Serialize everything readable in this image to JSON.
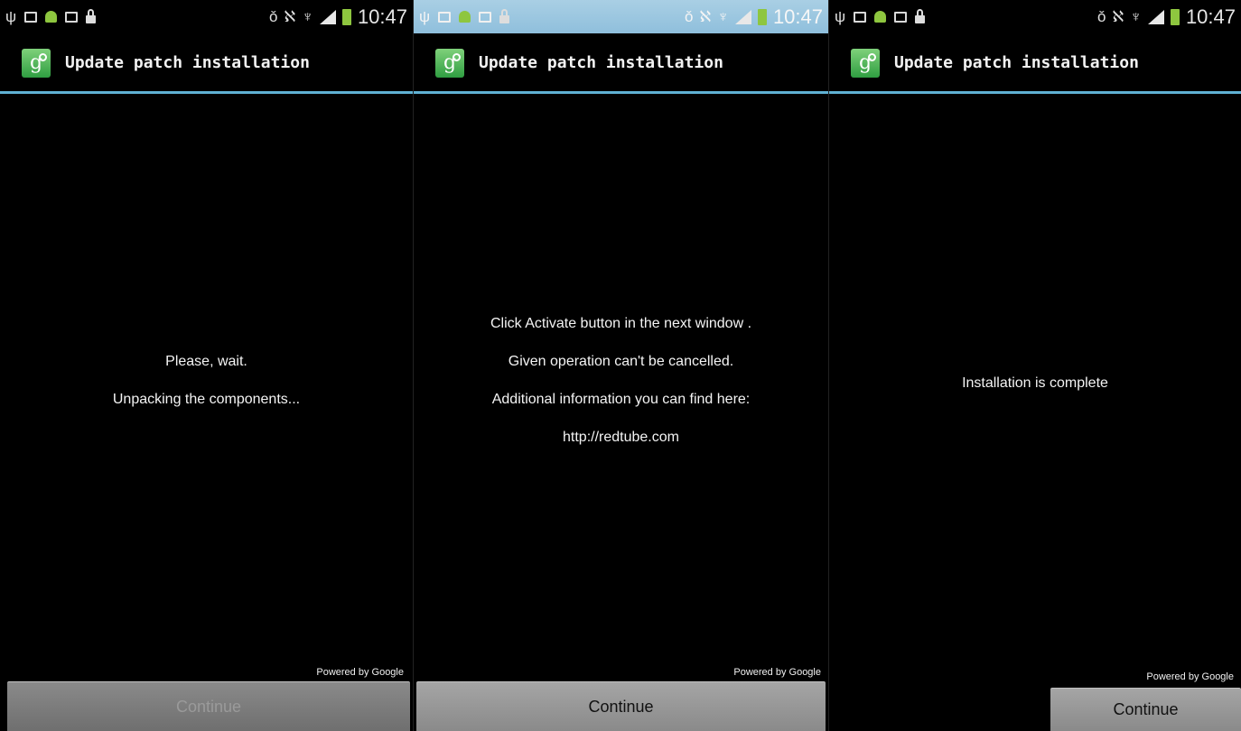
{
  "status_bar": {
    "time": "10:47"
  },
  "app": {
    "title": "Update patch installation",
    "icon": "google-settings-icon",
    "accent_color": "#5fb1d3"
  },
  "screens": [
    {
      "messages": [
        "Please, wait.",
        "Unpacking the components..."
      ],
      "powered_by": "Powered by Google",
      "continue_label": "Continue",
      "continue_enabled": false
    },
    {
      "messages": [
        "Click Activate button in the next window .",
        "Given operation can't be cancelled.",
        "Additional information you can find here:",
        "http://redtube.com"
      ],
      "powered_by": "Powered by Google",
      "continue_label": "Continue",
      "continue_enabled": true
    },
    {
      "messages": [
        "Installation is complete"
      ],
      "powered_by": "Powered by Google",
      "continue_label": "Continue",
      "continue_enabled": true
    }
  ]
}
